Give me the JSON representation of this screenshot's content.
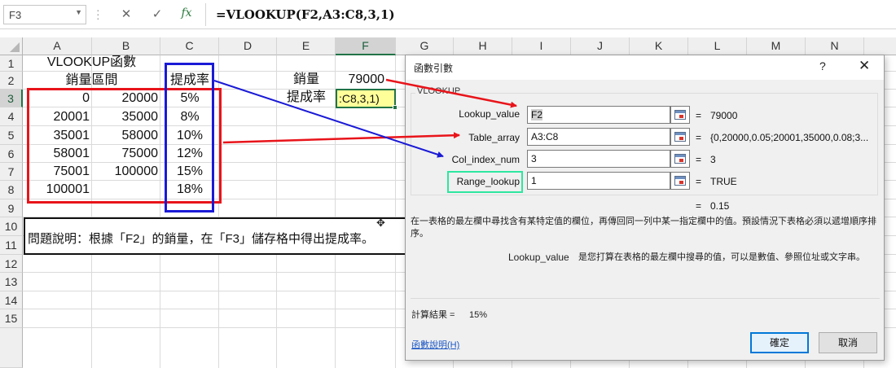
{
  "formula_bar": {
    "name_box": "F3",
    "cancel_glyph": "✕",
    "enter_glyph": "✓",
    "fx_glyph": "fx",
    "formula": "=VLOOKUP(F2,A3:C8,3,1)"
  },
  "columns": [
    "A",
    "B",
    "C",
    "D",
    "E",
    "F",
    "G",
    "H",
    "I",
    "J",
    "K",
    "L",
    "M",
    "N"
  ],
  "rows": [
    "1",
    "2",
    "3",
    "4",
    "5",
    "6",
    "7",
    "8",
    "9",
    "10",
    "11",
    "12",
    "13",
    "14",
    "15"
  ],
  "sheet": {
    "title": "VLOOKUP函數",
    "range_header": "銷量區間",
    "rate_header": "提成率",
    "table": [
      {
        "low": "0",
        "high": "20000",
        "rate": "5%"
      },
      {
        "low": "20001",
        "high": "35000",
        "rate": "8%"
      },
      {
        "low": "35001",
        "high": "58000",
        "rate": "10%"
      },
      {
        "low": "58001",
        "high": "75000",
        "rate": "12%"
      },
      {
        "low": "75001",
        "high": "100000",
        "rate": "15%"
      },
      {
        "low": "100001",
        "high": "",
        "rate": "18%"
      }
    ],
    "sales_label": "銷量",
    "sales_value": "79000",
    "rate_label": "提成率",
    "f3_text": ":C8,3,1)",
    "note": "問題說明：根據「F2」的銷量，在「F3」儲存格中得出提成率。"
  },
  "dialog": {
    "title": "函數引數",
    "help_glyph": "?",
    "close_glyph": "✕",
    "function_name": "VLOOKUP",
    "args": [
      {
        "label": "Lookup_value",
        "input": "F2",
        "result": "79000"
      },
      {
        "label": "Table_array",
        "input": "A3:C8",
        "result": "{0,20000,0.05;20001,35000,0.08;3..."
      },
      {
        "label": "Col_index_num",
        "input": "3",
        "result": "3"
      },
      {
        "label": "Range_lookup",
        "input": "1",
        "result": "TRUE"
      }
    ],
    "equals": "=",
    "function_result": "0.15",
    "description": "在一表格的最左欄中尋找含有某特定值的欄位，再傳回同一列中某一指定欄中的值。預設情況下表格必須以遞增順序排序。",
    "arg_help_name": "Lookup_value",
    "arg_help_text": "是您打算在表格的最左欄中搜尋的值，可以是數值、參照位址或文字串。",
    "calc_label": "計算結果 =",
    "calc_value": "15%",
    "help_link": "函數說明(H)",
    "ok_label": "確定",
    "cancel_label": "取消"
  },
  "annotation_colors": {
    "red": "#e8141a",
    "blue": "#1a1ad6",
    "green": "#2ee6a0"
  }
}
